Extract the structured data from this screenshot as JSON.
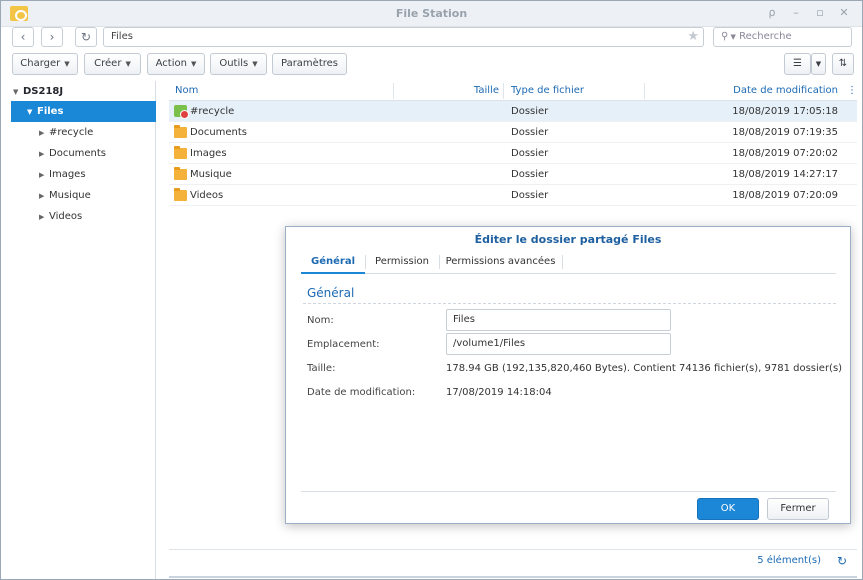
{
  "window": {
    "title": "File Station",
    "controls": [
      "pin-icon",
      "minimize-icon",
      "maximize-icon",
      "close-icon"
    ]
  },
  "nav": {
    "path": "Files",
    "search_placeholder": "Recherche"
  },
  "toolbar": {
    "charger": "Charger",
    "creer": "Créer",
    "action": "Action",
    "outils": "Outils",
    "parametres": "Paramètres"
  },
  "sidebar": {
    "root": "DS218J",
    "items": [
      {
        "label": "Files",
        "selected": true
      },
      {
        "label": "#recycle"
      },
      {
        "label": "Documents"
      },
      {
        "label": "Images"
      },
      {
        "label": "Musique"
      },
      {
        "label": "Videos"
      }
    ]
  },
  "list": {
    "headers": {
      "name": "Nom",
      "size": "Taille",
      "type": "Type de fichier",
      "date": "Date de modification"
    },
    "rows": [
      {
        "name": "#recycle",
        "type": "Dossier",
        "date": "18/08/2019 17:05:18",
        "icon": "recycle-bin-icon"
      },
      {
        "name": "Documents",
        "type": "Dossier",
        "date": "18/08/2019 07:19:35",
        "icon": "folder-icon"
      },
      {
        "name": "Images",
        "type": "Dossier",
        "date": "18/08/2019 07:20:02",
        "icon": "folder-icon"
      },
      {
        "name": "Musique",
        "type": "Dossier",
        "date": "18/08/2019 14:27:17",
        "icon": "folder-icon"
      },
      {
        "name": "Videos",
        "type": "Dossier",
        "date": "18/08/2019 07:20:09",
        "icon": "folder-icon"
      }
    ]
  },
  "status": {
    "count": "5 élément(s)"
  },
  "dialog": {
    "title": "Éditer le dossier partagé Files",
    "tabs": [
      "Général",
      "Permission",
      "Permissions avancées"
    ],
    "section": "Général",
    "fields": {
      "nom_label": "Nom:",
      "nom_value": "Files",
      "emplacement_label": "Emplacement:",
      "emplacement_value": "/volume1/Files",
      "taille_label": "Taille:",
      "taille_value": "178.94 GB (192,135,820,460 Bytes). Contient 74136 fichier(s), 9781 dossier(s)",
      "date_label": "Date de modification:",
      "date_value": "17/08/2019 14:18:04"
    },
    "ok": "OK",
    "cancel": "Fermer"
  },
  "colors": {
    "accent": "#1a87d7",
    "folder": "#f5b23a"
  }
}
